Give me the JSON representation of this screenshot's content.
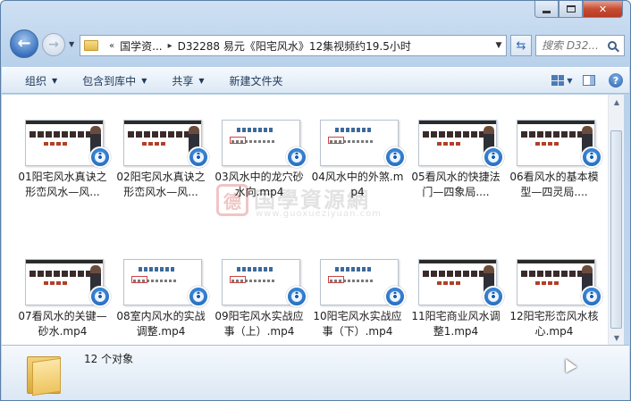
{
  "window": {
    "caption_buttons": [
      "minimize",
      "maximize",
      "close"
    ]
  },
  "nav": {
    "back_icon": "back-arrow-icon",
    "forward_icon": "forward-arrow-icon",
    "breadcrumb": [
      "国学资...",
      "D32288 易元《阳宅风水》12集视频约19.5小时"
    ],
    "search_placeholder": "搜索 D32..."
  },
  "toolbar": {
    "organize": "组织",
    "include_library": "包含到库中",
    "share": "共享",
    "new_folder": "新建文件夹"
  },
  "files": [
    {
      "name": "01阳宅风水真诀之形峦风水—风...",
      "thumb": "title"
    },
    {
      "name": "02阳宅风水真诀之形峦风水—风...",
      "thumb": "title"
    },
    {
      "name": "03风水中的龙穴砂水向.mp4",
      "thumb": "slide"
    },
    {
      "name": "04风水中的外煞.mp4",
      "thumb": "slide"
    },
    {
      "name": "05看风水的快捷法门—四象局....",
      "thumb": "title"
    },
    {
      "name": "06看风水的基本模型—四灵局....",
      "thumb": "title"
    },
    {
      "name": "07看风水的关键—砂水.mp4",
      "thumb": "title"
    },
    {
      "name": "08室内风水的实战调整.mp4",
      "thumb": "slide"
    },
    {
      "name": "09阳宅风水实战应事（上）.mp4",
      "thumb": "slide"
    },
    {
      "name": "10阳宅风水实战应事（下）.mp4",
      "thumb": "slide"
    },
    {
      "name": "11阳宅商业风水调整1.mp4",
      "thumb": "title"
    },
    {
      "name": "12阳宅形峦风水核心.mp4",
      "thumb": "title"
    }
  ],
  "watermark": {
    "logo": "德",
    "text": "国學資源網",
    "url": "www.guoxueziyuan.com"
  },
  "status": {
    "count": "12 个对象"
  },
  "colors": {
    "frame": "#b9d1ea",
    "badge": "#1b5fb3",
    "close": "#c74d33"
  }
}
